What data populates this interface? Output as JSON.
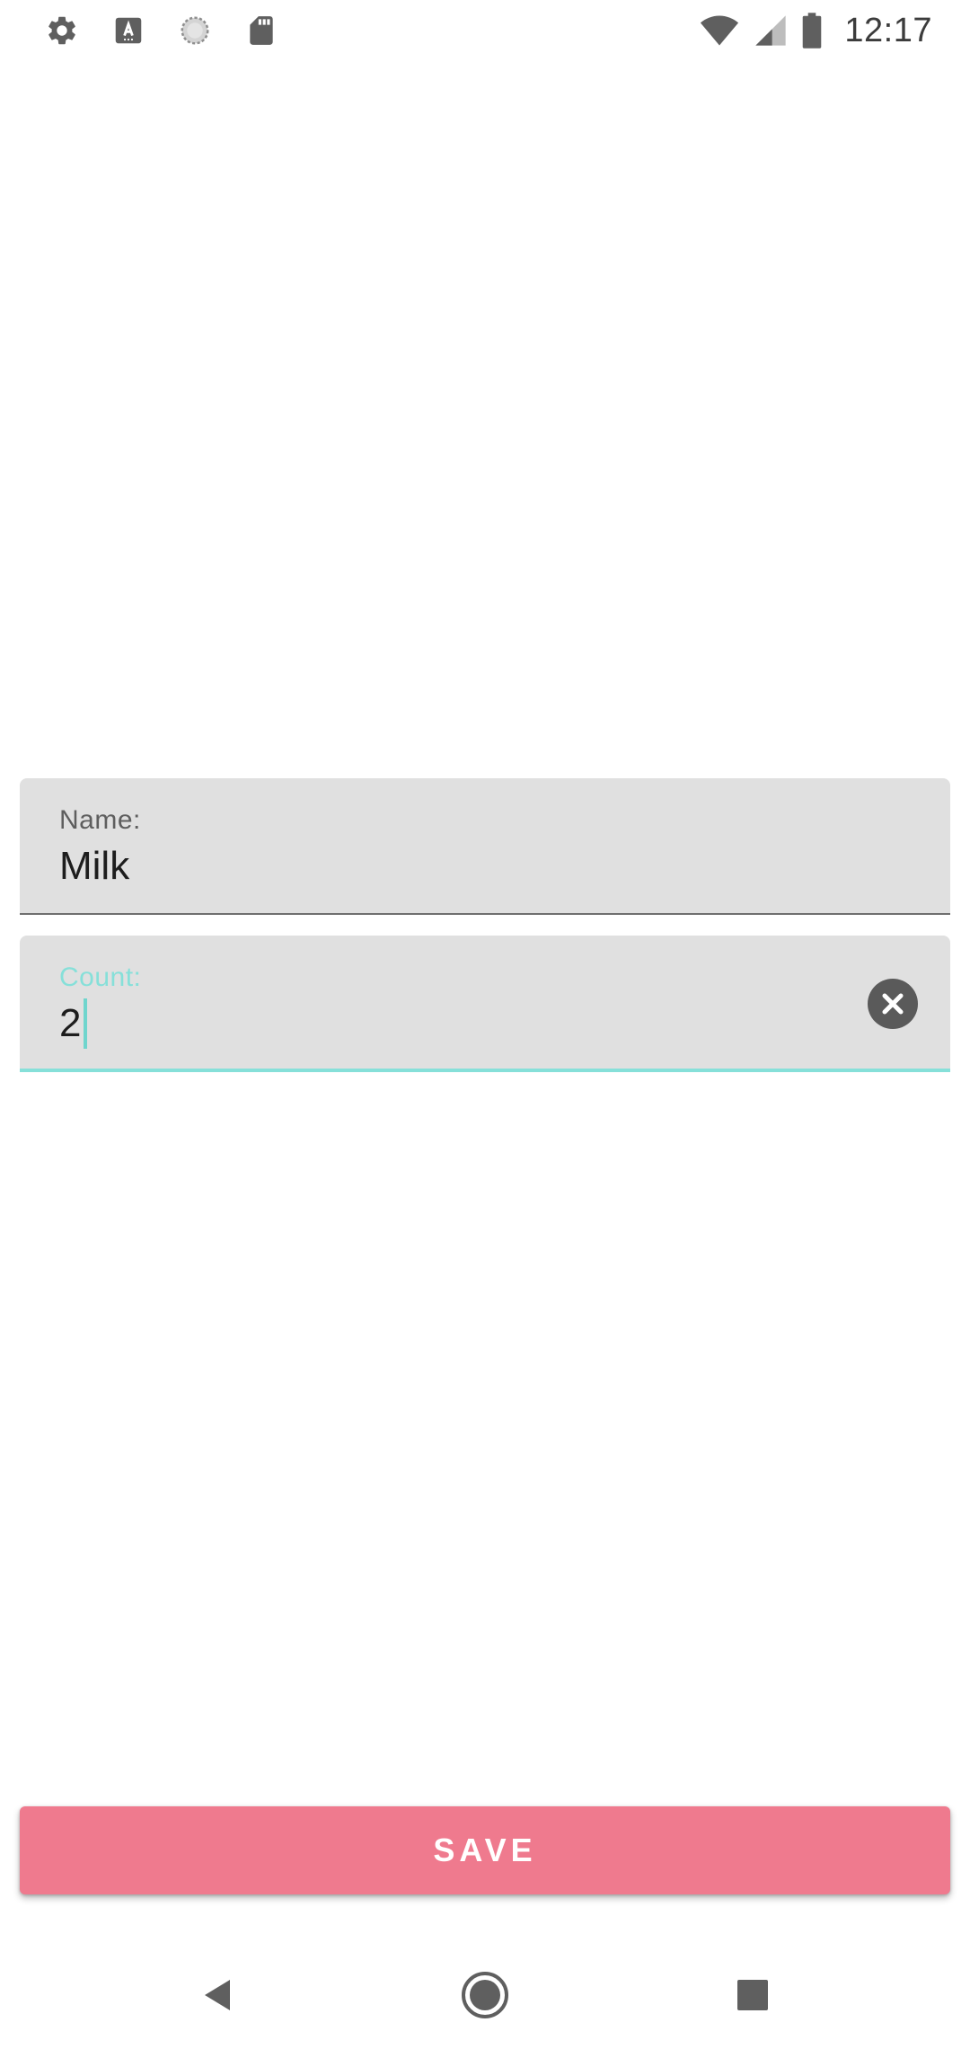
{
  "status_bar": {
    "time": "12:17",
    "left_icons": [
      "settings-icon",
      "keyboard-a-icon",
      "sync-circle-icon",
      "sd-card-icon"
    ],
    "right_icons": [
      "wifi-icon",
      "cell-signal-icon",
      "battery-icon"
    ]
  },
  "form": {
    "name_field": {
      "label": "Name:",
      "value": "Milk"
    },
    "count_field": {
      "label": "Count:",
      "value": "2",
      "focused": true,
      "clear_icon": "clear-circle-icon"
    }
  },
  "save_button": {
    "label": "SAVE"
  },
  "nav_bar": {
    "icons": [
      "back-icon",
      "home-icon",
      "recents-icon"
    ]
  },
  "colors": {
    "accent": "#86e0d9",
    "save_button": "#ef7a8e",
    "field_background": "#e0e0e0"
  }
}
